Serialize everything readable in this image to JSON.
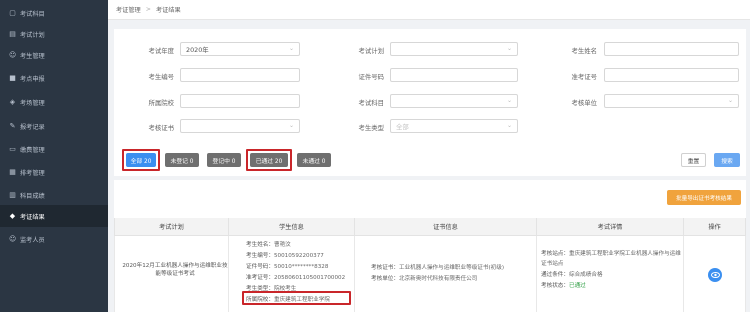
{
  "sidebar": {
    "items": [
      {
        "label": "考试科目",
        "icon": "book-icon"
      },
      {
        "label": "考试计划",
        "icon": "calendar-icon"
      },
      {
        "label": "考生管理",
        "icon": "user-icon"
      },
      {
        "label": "考点申报",
        "icon": "flag-icon"
      },
      {
        "label": "考场管理",
        "icon": "room-icon"
      },
      {
        "label": "报考记录",
        "icon": "record-icon"
      },
      {
        "label": "缴费管理",
        "icon": "payment-icon"
      },
      {
        "label": "排考管理",
        "icon": "schedule-icon"
      },
      {
        "label": "科目成绩",
        "icon": "score-icon"
      },
      {
        "label": "考证结果",
        "icon": "certificate-icon",
        "active": true
      },
      {
        "label": "监考人员",
        "icon": "staff-icon"
      }
    ]
  },
  "breadcrumb": {
    "parent": "考证管理",
    "separator": ">",
    "current": "考证结果"
  },
  "filters": {
    "exam_year_label": "考试年度",
    "exam_year_value": "2020年",
    "exam_plan_label": "考试计划",
    "student_name_label": "考生姓名",
    "student_no_label": "考生编号",
    "id_no_label": "证件号码",
    "ticket_no_label": "准考证号",
    "school_label": "所属院校",
    "subject_label": "考试科目",
    "cert_unit_label": "考核单位",
    "cert_label": "考核证书",
    "student_type_label": "考生类型",
    "student_type_placeholder": "全部"
  },
  "status_tabs": [
    {
      "label": "全部 20",
      "color": "#3b8ff0"
    },
    {
      "label": "未登记 0",
      "color": "#6f6f6f"
    },
    {
      "label": "登记中 0",
      "color": "#6f6f6f"
    },
    {
      "label": "已通过 20",
      "color": "#6f6f6f"
    },
    {
      "label": "未通过 0",
      "color": "#6f6f6f"
    }
  ],
  "actions": {
    "reset": "重置",
    "search": "搜索",
    "batch": "批量导出证书考核结果"
  },
  "table": {
    "headers": [
      "考试计划",
      "学生信息",
      "证书信息",
      "考试详情",
      "操作"
    ],
    "row": {
      "plan": "2020年12月工业机器人操作与运维职业技能等级证书考试",
      "student": {
        "name_label": "考生姓名：",
        "name": "曹艳汶",
        "no_label": "考生编号：",
        "no": "50010592200377",
        "id_label": "证件号码：",
        "id": "50010********8328",
        "ticket_label": "准考证号：",
        "ticket": "20580601105001700002",
        "type_label": "考生类型：",
        "type": "院校考生",
        "school_label": "所属院校：",
        "school": "重庆建筑工程职业学院"
      },
      "cert": {
        "cert_label": "考核证书：",
        "cert": "工业机器人操作与运维职业等级证书(初级)",
        "unit_label": "考核单位：",
        "unit": "北京新奥时代科技有限责任公司"
      },
      "detail": {
        "site_label": "考核站点：",
        "site": "重庆建筑工程职业学院工业机器人操作与运维",
        "site_cont": "证书站点",
        "cond_label": "通过条件：",
        "cond": "综合成绩合格",
        "status_label": "考核状态：",
        "status": "已通过"
      },
      "action_icon": "eye-icon"
    }
  },
  "highlight_color": "#c9262a"
}
